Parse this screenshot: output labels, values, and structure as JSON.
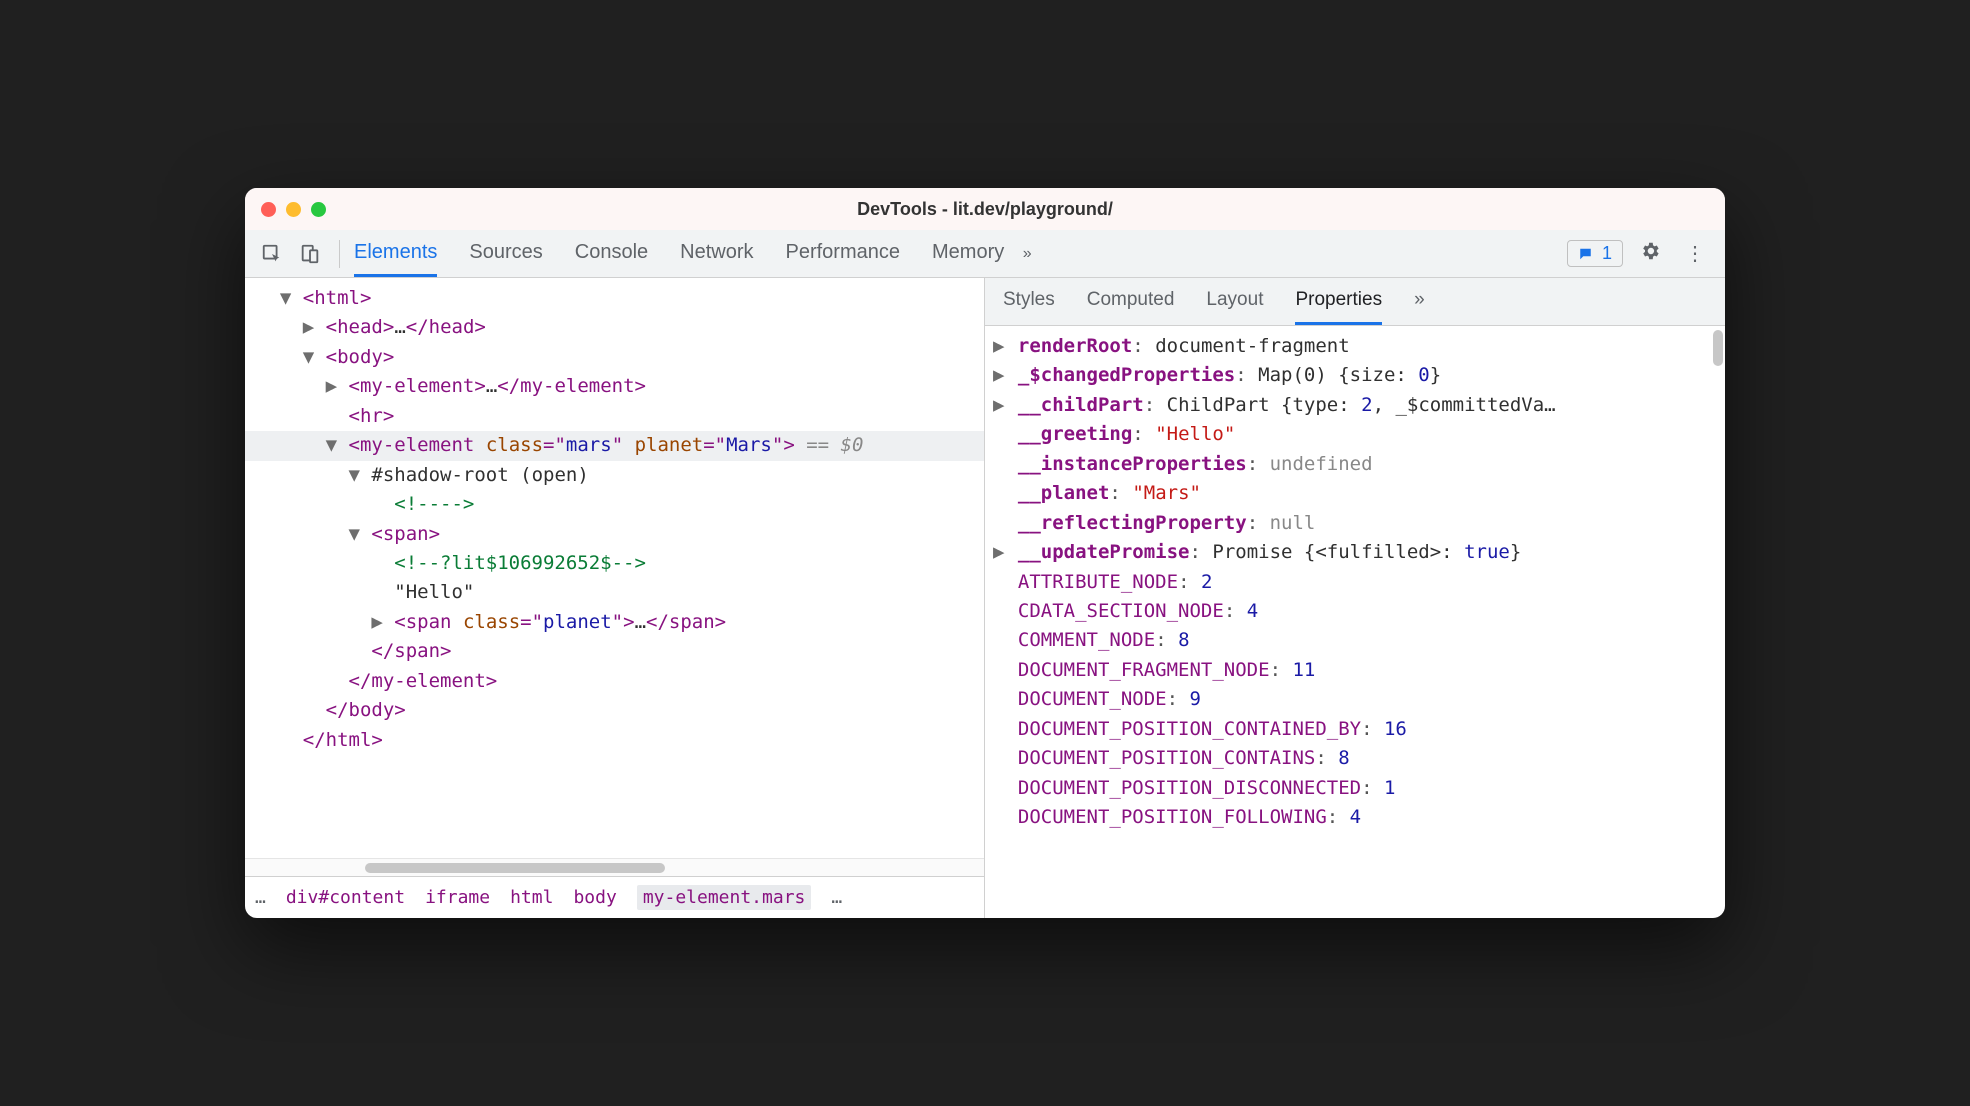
{
  "window": {
    "title": "DevTools - lit.dev/playground/"
  },
  "toolbar": {
    "tabs": [
      "Elements",
      "Sources",
      "Console",
      "Network",
      "Performance",
      "Memory"
    ],
    "more": "»",
    "issues_count": "1"
  },
  "dom": {
    "lines": [
      {
        "indent": 1,
        "toggle": "▼",
        "parts": [
          [
            "tag",
            "<html>"
          ]
        ]
      },
      {
        "indent": 2,
        "toggle": "▶",
        "parts": [
          [
            "tag",
            "<head>"
          ],
          [
            "txt",
            "…"
          ],
          [
            "tag",
            "</head>"
          ]
        ]
      },
      {
        "indent": 2,
        "toggle": "▼",
        "parts": [
          [
            "tag",
            "<body>"
          ]
        ]
      },
      {
        "indent": 3,
        "toggle": "▶",
        "parts": [
          [
            "tag",
            "<my-element>"
          ],
          [
            "txt",
            "…"
          ],
          [
            "tag",
            "</my-element>"
          ]
        ]
      },
      {
        "indent": 3,
        "toggle": "",
        "parts": [
          [
            "tag",
            "<hr>"
          ]
        ]
      },
      {
        "indent": 3,
        "toggle": "▼",
        "hl": true,
        "parts": [
          [
            "tag",
            "<my-element "
          ],
          [
            "attr-name",
            "class"
          ],
          [
            "tag",
            "=\""
          ],
          [
            "attr-val",
            "mars"
          ],
          [
            "tag",
            "\" "
          ],
          [
            "attr-name",
            "planet"
          ],
          [
            "tag",
            "=\""
          ],
          [
            "attr-val",
            "Mars"
          ],
          [
            "tag",
            "\">"
          ],
          [
            "gray",
            " == $0"
          ]
        ]
      },
      {
        "indent": 4,
        "toggle": "▼",
        "parts": [
          [
            "txt",
            "#shadow-root (open)"
          ]
        ]
      },
      {
        "indent": 5,
        "toggle": "",
        "parts": [
          [
            "cmt",
            "<!---->"
          ]
        ]
      },
      {
        "indent": 4,
        "toggle": "▼",
        "parts": [
          [
            "tag",
            "<span>"
          ]
        ]
      },
      {
        "indent": 5,
        "toggle": "",
        "parts": [
          [
            "cmt",
            "<!--?lit$106992652$-->"
          ]
        ]
      },
      {
        "indent": 5,
        "toggle": "",
        "parts": [
          [
            "txt",
            "\"Hello\""
          ]
        ]
      },
      {
        "indent": 5,
        "toggle": "▶",
        "parts": [
          [
            "tag",
            "<span "
          ],
          [
            "attr-name",
            "class"
          ],
          [
            "tag",
            "=\""
          ],
          [
            "attr-val",
            "planet"
          ],
          [
            "tag",
            "\">"
          ],
          [
            "txt",
            "…"
          ],
          [
            "tag",
            "</span>"
          ]
        ]
      },
      {
        "indent": 4,
        "toggle": "",
        "parts": [
          [
            "tag",
            "</span>"
          ]
        ]
      },
      {
        "indent": 3,
        "toggle": "",
        "parts": [
          [
            "tag",
            "</my-element>"
          ]
        ]
      },
      {
        "indent": 2,
        "toggle": "",
        "parts": [
          [
            "tag",
            "</body>"
          ]
        ]
      },
      {
        "indent": 1,
        "toggle": "",
        "parts": [
          [
            "tag",
            "</html>"
          ]
        ]
      }
    ]
  },
  "breadcrumb": {
    "ellipsis_left": "…",
    "items": [
      "div#content",
      "iframe",
      "html",
      "body",
      "my-element.mars"
    ],
    "active_index": 4,
    "ellipsis_right": "…"
  },
  "subtabs": {
    "items": [
      "Styles",
      "Computed",
      "Layout",
      "Properties"
    ],
    "more": "»",
    "active_index": 3
  },
  "properties": [
    {
      "exp": "▶",
      "key": "renderRoot",
      "bold": true,
      "value": [
        [
          "vword",
          "document-fragment"
        ]
      ]
    },
    {
      "exp": "▶",
      "key": "_$changedProperties",
      "bold": true,
      "value": [
        [
          "vword",
          "Map(0) {size: "
        ],
        [
          "vnum",
          "0"
        ],
        [
          "vword",
          "}"
        ]
      ]
    },
    {
      "exp": "▶",
      "key": "__childPart",
      "bold": true,
      "value": [
        [
          "vword",
          "ChildPart {type: "
        ],
        [
          "vnum",
          "2"
        ],
        [
          "vword",
          ", _$committedVa…"
        ]
      ]
    },
    {
      "exp": "",
      "key": "__greeting",
      "bold": true,
      "value": [
        [
          "vstr",
          "\"Hello\""
        ]
      ]
    },
    {
      "exp": "",
      "key": "__instanceProperties",
      "bold": true,
      "value": [
        [
          "vgray",
          "undefined"
        ]
      ]
    },
    {
      "exp": "",
      "key": "__planet",
      "bold": true,
      "value": [
        [
          "vstr",
          "\"Mars\""
        ]
      ]
    },
    {
      "exp": "",
      "key": "__reflectingProperty",
      "bold": true,
      "value": [
        [
          "vgray",
          "null"
        ]
      ]
    },
    {
      "exp": "▶",
      "key": "__updatePromise",
      "bold": true,
      "value": [
        [
          "vword",
          "Promise {<fulfilled>: "
        ],
        [
          "vnum",
          "true"
        ],
        [
          "vword",
          "}"
        ]
      ]
    },
    {
      "exp": "",
      "key": "ATTRIBUTE_NODE",
      "bold": false,
      "value": [
        [
          "vnum",
          "2"
        ]
      ]
    },
    {
      "exp": "",
      "key": "CDATA_SECTION_NODE",
      "bold": false,
      "value": [
        [
          "vnum",
          "4"
        ]
      ]
    },
    {
      "exp": "",
      "key": "COMMENT_NODE",
      "bold": false,
      "value": [
        [
          "vnum",
          "8"
        ]
      ]
    },
    {
      "exp": "",
      "key": "DOCUMENT_FRAGMENT_NODE",
      "bold": false,
      "value": [
        [
          "vnum",
          "11"
        ]
      ]
    },
    {
      "exp": "",
      "key": "DOCUMENT_NODE",
      "bold": false,
      "value": [
        [
          "vnum",
          "9"
        ]
      ]
    },
    {
      "exp": "",
      "key": "DOCUMENT_POSITION_CONTAINED_BY",
      "bold": false,
      "value": [
        [
          "vnum",
          "16"
        ]
      ]
    },
    {
      "exp": "",
      "key": "DOCUMENT_POSITION_CONTAINS",
      "bold": false,
      "value": [
        [
          "vnum",
          "8"
        ]
      ]
    },
    {
      "exp": "",
      "key": "DOCUMENT_POSITION_DISCONNECTED",
      "bold": false,
      "value": [
        [
          "vnum",
          "1"
        ]
      ]
    },
    {
      "exp": "",
      "key": "DOCUMENT_POSITION_FOLLOWING",
      "bold": false,
      "value": [
        [
          "vnum",
          "4"
        ]
      ]
    }
  ]
}
